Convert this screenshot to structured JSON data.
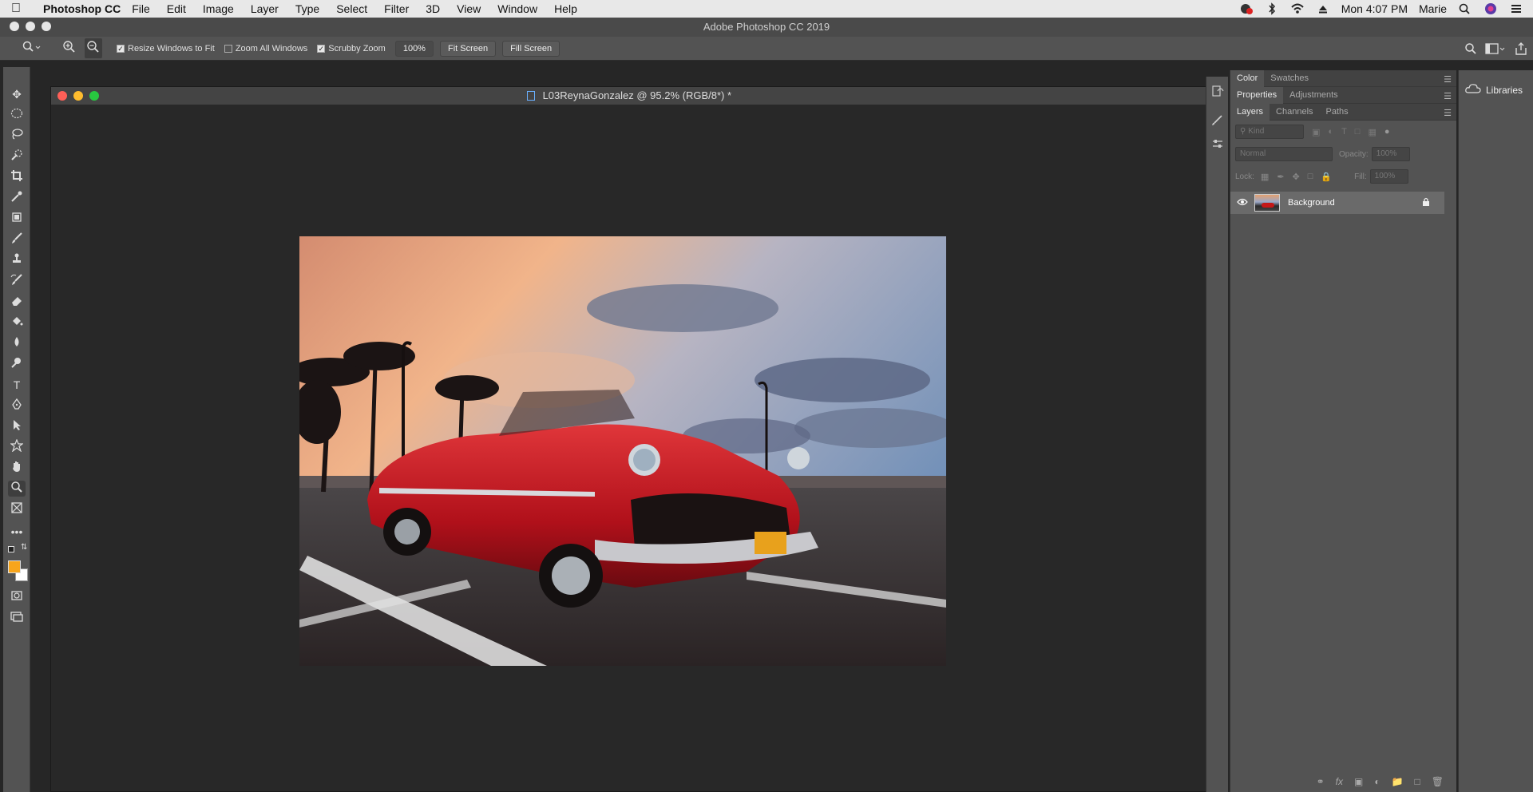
{
  "menubar": {
    "app_name": "Photoshop CC",
    "items": [
      "File",
      "Edit",
      "Image",
      "Layer",
      "Type",
      "Select",
      "Filter",
      "3D",
      "View",
      "Window",
      "Help"
    ],
    "clock": "Mon 4:07 PM",
    "user": "Marie"
  },
  "window": {
    "title": "Adobe Photoshop CC 2019"
  },
  "options": {
    "resize_windows_label": "Resize Windows to Fit",
    "zoom_all_label": "Zoom All Windows",
    "scrubby_label": "Scrubby Zoom",
    "zoom_value": "100%",
    "fit_screen_label": "Fit Screen",
    "fill_screen_label": "Fill Screen"
  },
  "document": {
    "title": "L03ReynaGonzalez @ 95.2% (RGB/8*) *"
  },
  "panels": {
    "color_tab": "Color",
    "swatches_tab": "Swatches",
    "properties_tab": "Properties",
    "adjustments_tab": "Adjustments",
    "layers_tab": "Layers",
    "channels_tab": "Channels",
    "paths_tab": "Paths",
    "kind_filter": "Kind",
    "blend_mode": "Normal",
    "opacity_label": "Opacity:",
    "opacity_value": "100%",
    "lock_label": "Lock:",
    "fill_label": "Fill:",
    "fill_value": "100%",
    "layer_name": "Background"
  },
  "libraries": {
    "label": "Libraries"
  },
  "colors": {
    "foreground": "#f7a51c",
    "background": "#ffffff",
    "accent_selected_layer": "#6a6a6a"
  }
}
